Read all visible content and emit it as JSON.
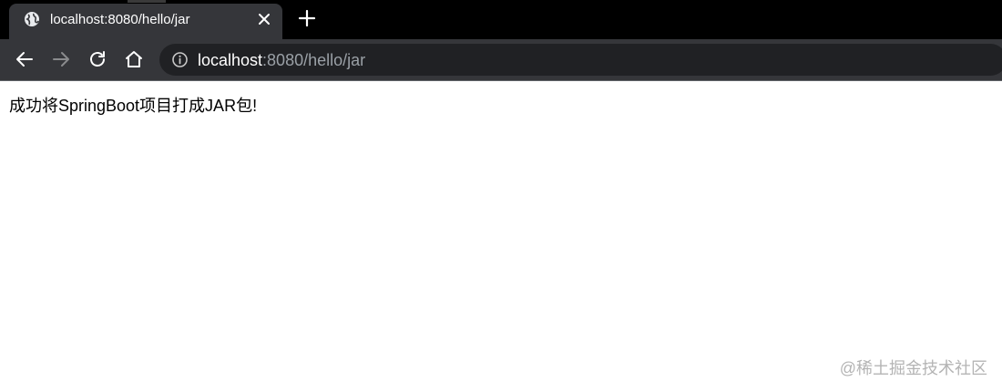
{
  "browser": {
    "tab": {
      "title": "localhost:8080/hello/jar",
      "favicon_icon": "globe-icon",
      "close_icon": "close-icon"
    },
    "new_tab_icon": "plus-icon",
    "nav": {
      "back_icon": "arrow-left-icon",
      "forward_icon": "arrow-right-icon",
      "reload_icon": "reload-icon",
      "home_icon": "home-icon"
    },
    "address_bar": {
      "info_icon": "info-icon",
      "host": "localhost",
      "rest": ":8080/hello/jar"
    }
  },
  "page": {
    "message": "成功将SpringBoot项目打成JAR包!"
  },
  "watermark": "@稀土掘金技术社区",
  "colors": {
    "tabstrip_bg": "#000000",
    "toolbar_bg": "#35363a",
    "omnibox_bg": "#202124",
    "url_dim": "#9aa0a6"
  }
}
